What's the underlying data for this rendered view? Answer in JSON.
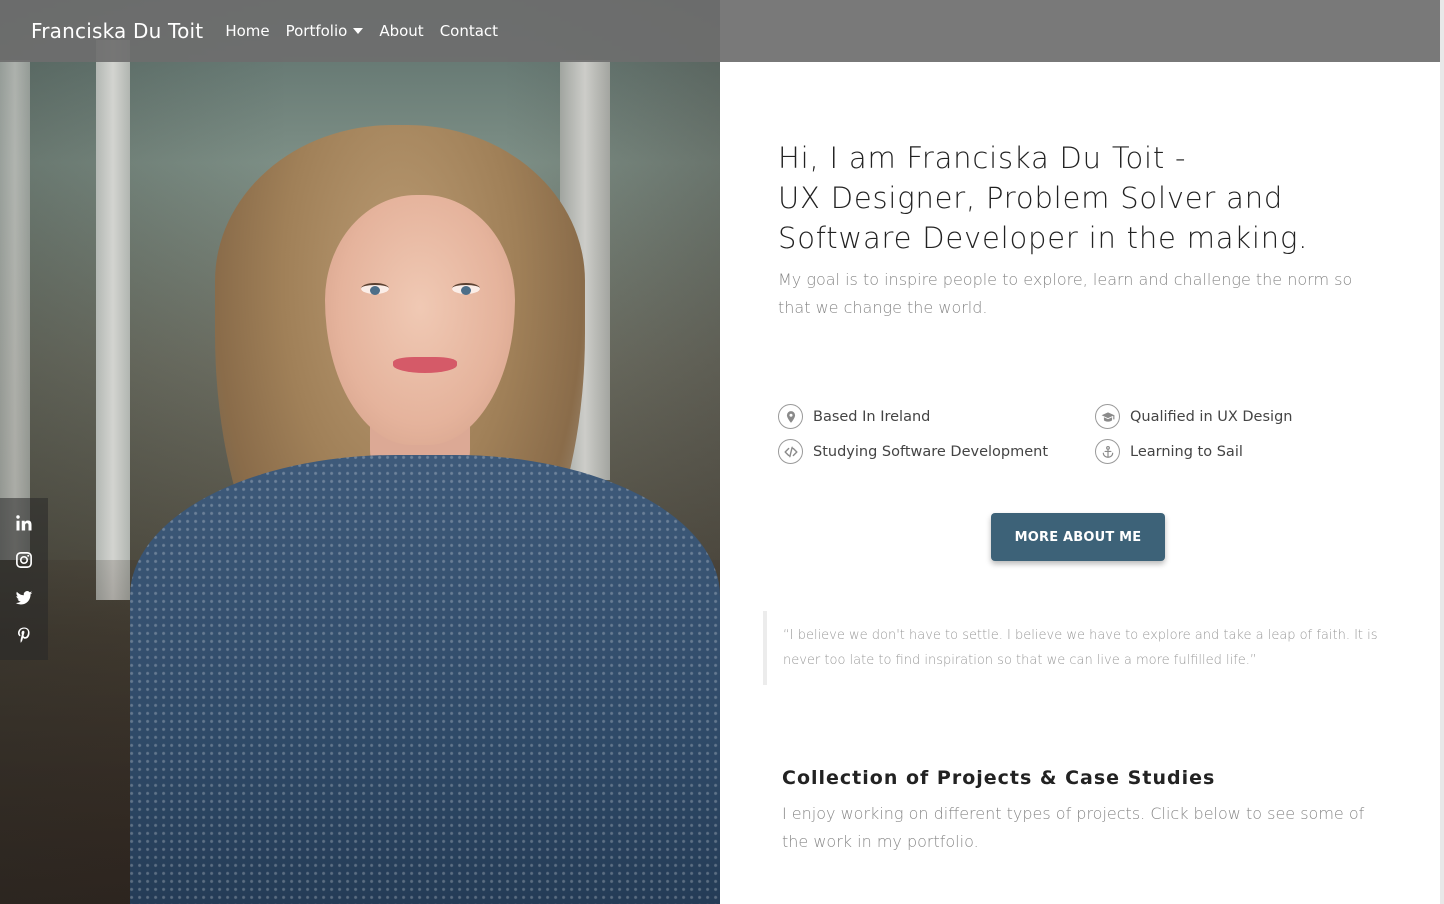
{
  "navbar": {
    "brand": "Franciska Du Toit",
    "links": [
      "Home",
      "Portfolio",
      "About",
      "Contact"
    ]
  },
  "social": {
    "icons": [
      "linkedin-icon",
      "instagram-icon",
      "twitter-icon",
      "pinterest-icon"
    ]
  },
  "hero": {
    "headline_lines": [
      "Hi, I am Franciska Du Toit -",
      "UX Designer, Problem Solver and",
      "Software Developer in the making."
    ],
    "lead": "My goal is to inspire people to explore, learn and challenge the norm so that we change the world."
  },
  "facts": [
    {
      "icon": "map-pin-icon",
      "label": "Based In Ireland"
    },
    {
      "icon": "graduation-cap-icon",
      "label": "Qualified in UX Design"
    },
    {
      "icon": "code-icon",
      "label": "Studying Software Development"
    },
    {
      "icon": "anchor-icon",
      "label": "Learning to Sail"
    }
  ],
  "cta": {
    "label": "MORE ABOUT ME"
  },
  "quote": "“I believe we don't have to settle. I believe we have to explore and take a leap of faith. It is never too late to find inspiration so that we can live a more fulfilled life.”",
  "projects": {
    "title": "Collection of Projects & Case Studies",
    "text": "I enjoy working on different types of projects. Click below to see some of the work in my portfolio."
  },
  "colors": {
    "navbar_bg": "#6e6e6e",
    "button_bg": "#3d6278",
    "muted_text": "#888888"
  }
}
